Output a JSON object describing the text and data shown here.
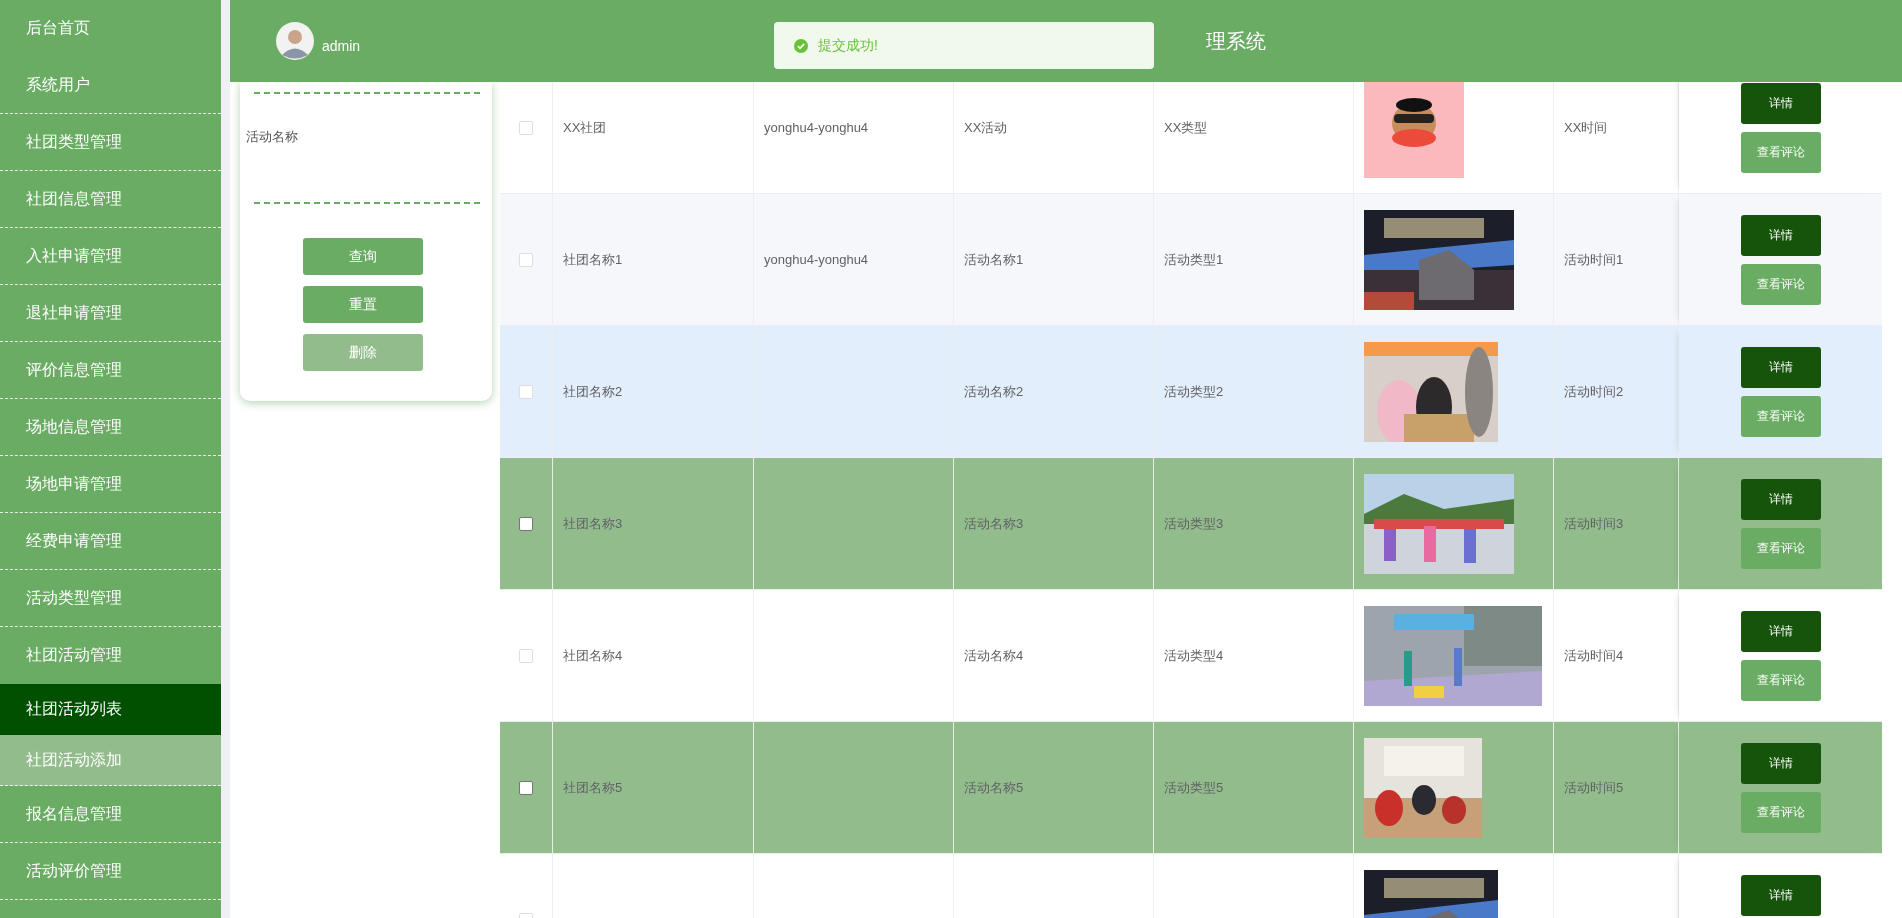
{
  "sidebar": {
    "items": [
      {
        "label": "后台首页",
        "selected": false
      },
      {
        "label": "系统用户",
        "selected": false
      },
      {
        "label": "社团类型管理",
        "selected": false
      },
      {
        "label": "社团信息管理",
        "selected": false
      },
      {
        "label": "入社申请管理",
        "selected": false
      },
      {
        "label": "退社申请管理",
        "selected": false
      },
      {
        "label": "评价信息管理",
        "selected": false
      },
      {
        "label": "场地信息管理",
        "selected": false
      },
      {
        "label": "场地申请管理",
        "selected": false
      },
      {
        "label": "经费申请管理",
        "selected": false
      },
      {
        "label": "活动类型管理",
        "selected": false
      },
      {
        "label": "社团活动管理",
        "selected": false,
        "children": [
          {
            "label": "社团活动列表",
            "selected": true
          },
          {
            "label": "社团活动添加",
            "selected": false
          }
        ]
      },
      {
        "label": "报名信息管理",
        "selected": false
      },
      {
        "label": "活动评价管理",
        "selected": false
      }
    ]
  },
  "header": {
    "user": "admin",
    "title": "理系统"
  },
  "toast": {
    "message": "提交成功!"
  },
  "search_panel": {
    "label": "活动名称",
    "buttons": [
      {
        "label": "查询",
        "disabled": false
      },
      {
        "label": "重置",
        "disabled": false
      },
      {
        "label": "删除",
        "disabled": true
      }
    ]
  },
  "table": {
    "rows": [
      {
        "club": "XX社团",
        "user": "yonghu4-yonghu4",
        "activity": "XX活动",
        "type": "XX类型",
        "time": "XX时间",
        "selected": false,
        "hovered": false,
        "actions": [
          {
            "label": "详情",
            "kind": "primary"
          },
          {
            "label": "查看评论",
            "kind": "secondary"
          }
        ]
      },
      {
        "club": "社团名称1",
        "user": "yonghu4-yonghu4",
        "activity": "活动名称1",
        "type": "活动类型1",
        "time": "活动时间1",
        "selected": false,
        "hovered": false,
        "actions": [
          {
            "label": "详情",
            "kind": "primary"
          },
          {
            "label": "查看评论",
            "kind": "secondary"
          }
        ]
      },
      {
        "club": "社团名称2",
        "activity": "活动名称2",
        "type": "活动类型2",
        "time": "活动时间2",
        "selected": false,
        "hovered": true,
        "actions": [
          {
            "label": "详情",
            "kind": "primary"
          },
          {
            "label": "查看评论",
            "kind": "secondary"
          }
        ]
      },
      {
        "club": "社团名称3",
        "activity": "活动名称3",
        "type": "活动类型3",
        "time": "活动时间3",
        "selected": true,
        "hovered": false,
        "actions": [
          {
            "label": "详情",
            "kind": "primary"
          },
          {
            "label": "查看评论",
            "kind": "secondary"
          }
        ]
      },
      {
        "club": "社团名称4",
        "activity": "活动名称4",
        "type": "活动类型4",
        "time": "活动时间4",
        "selected": false,
        "hovered": false,
        "actions": [
          {
            "label": "详情",
            "kind": "primary"
          },
          {
            "label": "查看评论",
            "kind": "secondary"
          }
        ]
      },
      {
        "club": "社团名称5",
        "activity": "活动名称5",
        "type": "活动类型5",
        "time": "活动时间5",
        "selected": true,
        "hovered": false,
        "actions": [
          {
            "label": "详情",
            "kind": "primary"
          },
          {
            "label": "查看评论",
            "kind": "secondary"
          }
        ]
      },
      {
        "selected": false,
        "hovered": false,
        "actions": [
          {
            "label": "详情",
            "kind": "primary"
          }
        ]
      }
    ]
  }
}
